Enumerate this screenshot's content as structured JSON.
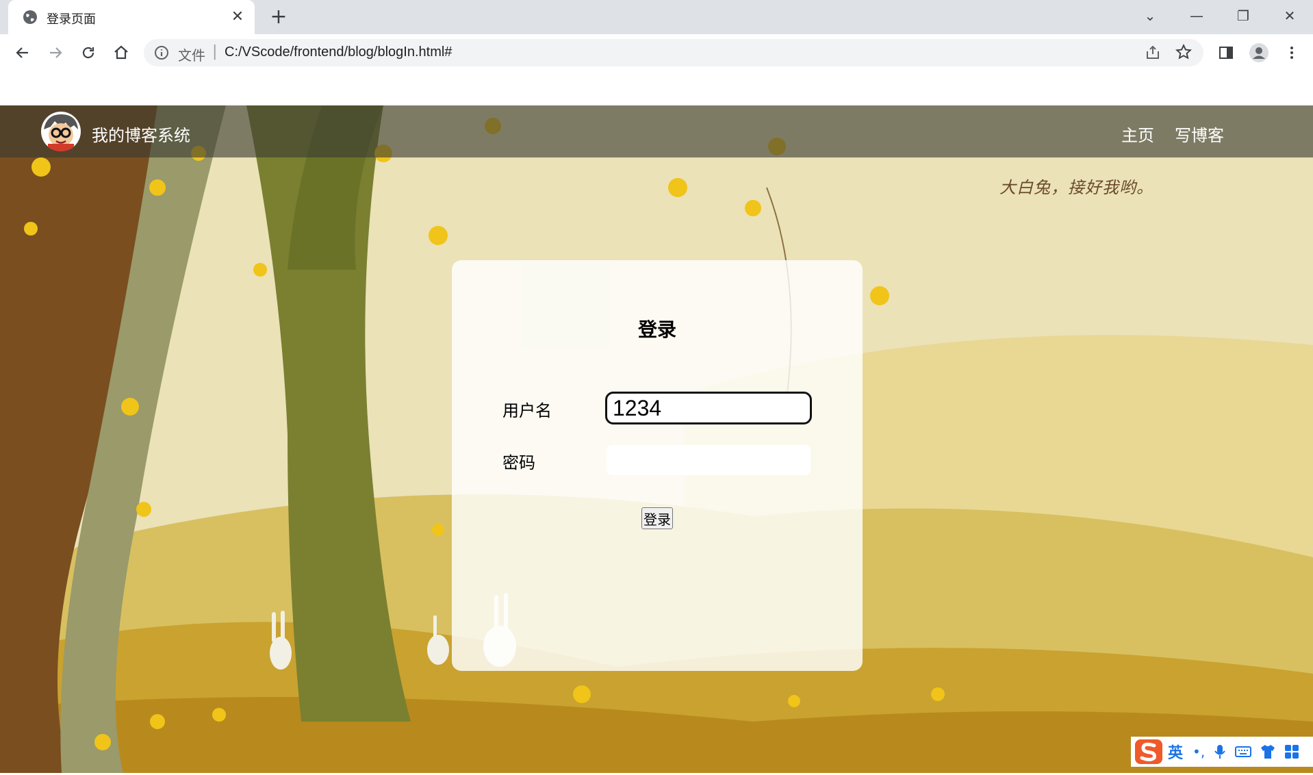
{
  "browser": {
    "tab_title": "登录页面",
    "tab_close": "✕",
    "new_tab": "+",
    "omnibox_scheme": "文件",
    "omnibox_separator": "|",
    "url": "C:/VScode/frontend/blog/blogIn.html#",
    "window_controls": {
      "dropdown": "⌄",
      "minimize": "—",
      "restore": "❐",
      "close": "✕"
    }
  },
  "navbar": {
    "site_name": "我的博客系统",
    "links": [
      {
        "label": "主页"
      },
      {
        "label": "写博客"
      }
    ]
  },
  "quote": "大白兔，接好我哟。",
  "login": {
    "title": "登录",
    "username_label": "用户名",
    "username_value": "1234",
    "password_label": "密码",
    "password_value": "",
    "submit_label": "登录"
  },
  "ime": {
    "lang": "英",
    "punct": "•,",
    "icons": [
      "mic-icon",
      "keyboard-icon",
      "skin-icon",
      "toolbox-icon"
    ]
  },
  "colors": {
    "navbar_bg": "#4b4a3c",
    "scene_sky": "#ebe2b8",
    "ground": "#c9a230",
    "accent_leaf": "#f0c419"
  }
}
